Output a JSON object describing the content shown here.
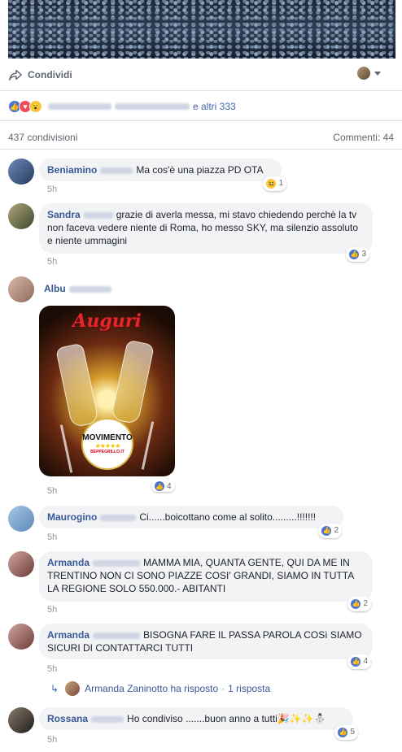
{
  "post": {
    "share_label": "Condividi",
    "reactions_suffix": "e altri 333",
    "shares_count": "437 condivisioni",
    "comments_count": "Commenti: 44"
  },
  "comments": [
    {
      "author": "Beniamino",
      "text": "Ma cos'è una piazza PD OTA",
      "time": "5h",
      "reaction": "haha",
      "count": "1"
    },
    {
      "author": "Sandra",
      "text": "grazie di averla messa, mi stavo chiedendo perchè la tv non faceva vedere niente di Roma, ho messo SKY, ma silenzio assoluto e niente ummagini",
      "time": "5h",
      "reaction": "like",
      "count": "3"
    },
    {
      "author": "Albu",
      "text": "",
      "time": "5h",
      "reaction": "like",
      "count": "4",
      "image_title": "Auguri",
      "logo_text": "MOVIMENTO",
      "logo_sub": "BEPPEGRILLO.IT"
    },
    {
      "author": "Maurogino",
      "text": "Ci......boicottano come al solito.........!!!!!!!",
      "time": "5h",
      "reaction": "like",
      "count": "2"
    },
    {
      "author": "Armanda",
      "text": "MAMMA MIA, QUANTA GENTE, QUI DA ME IN TRENTINO NON CI SONO PIAZZE COSI' GRANDI, SIAMO IN TUTTA LA REGIONE SOLO 550.000.- ABITANTI",
      "time": "5h",
      "reaction": "like",
      "count": "2"
    },
    {
      "author": "Armanda",
      "text": "BISOGNA FARE IL PASSA PAROLA COSì SIAMO SICURI DI CONTATTARCI TUTTI",
      "time": "5h",
      "reaction": "like",
      "count": "4"
    },
    {
      "author": "Rossana",
      "text": "Ho condiviso .......buon anno a tutti🎉✨✨⛄",
      "time": "5h",
      "reaction": "like",
      "count": "5"
    }
  ],
  "reply": {
    "text": "Armanda Zaninotto ha risposto",
    "count": "1 risposta"
  },
  "colors": {
    "link": "#385898",
    "like": "#4a76d0",
    "love": "#ef4d5e",
    "wow": "#f7c93f"
  }
}
